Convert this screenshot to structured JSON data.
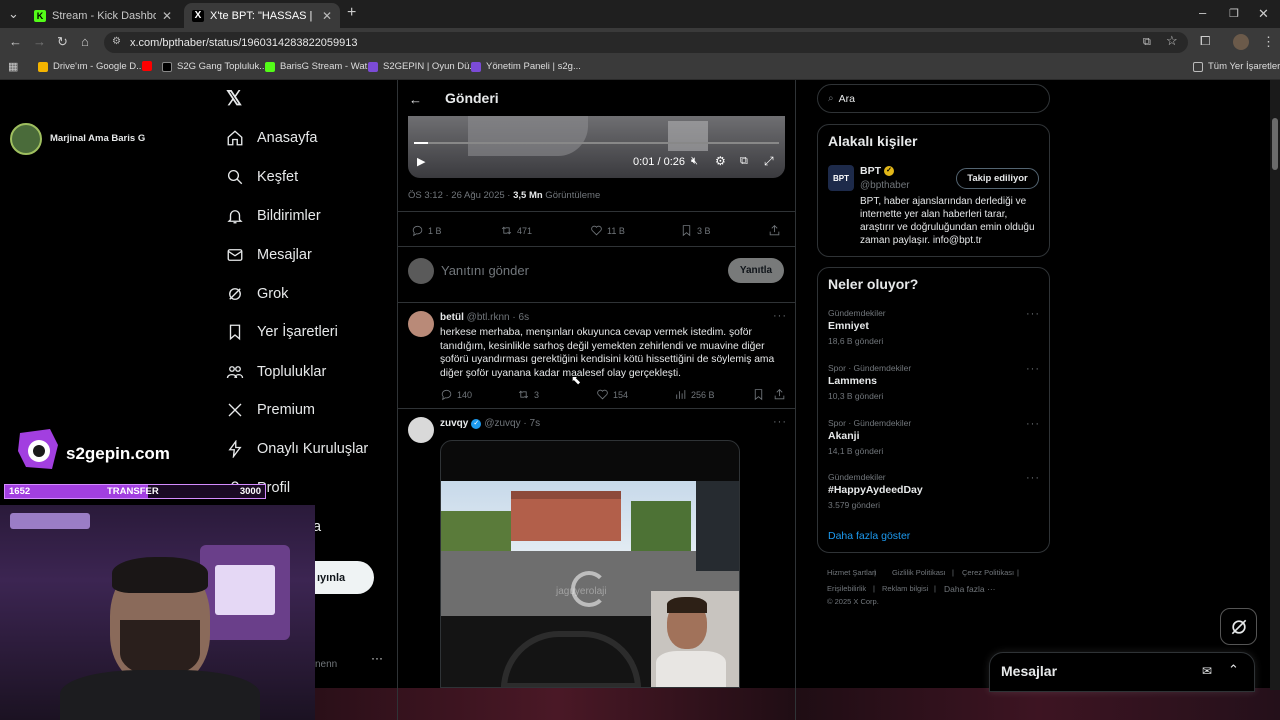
{
  "browser": {
    "tabs": [
      {
        "title": "Stream - Kick Dashboard",
        "favicon_color": "#53fc18",
        "favicon_text": "K"
      },
      {
        "title": "X'te BPT: \"HASSAS | Samsun'da",
        "favicon_color": "#000000",
        "favicon_text": "X"
      }
    ],
    "url": "x.com/bpthaber/status/1960314283822059913",
    "bookmarks": [
      {
        "label": "Drive'ım - Google D...",
        "color": "#f4b400"
      },
      {
        "label": "S2G Gang Topluluk...",
        "color": "#000000"
      },
      {
        "label": "BarisG Stream - Wat...",
        "color": "#53fc18"
      },
      {
        "label": "S2GEPIN | Oyun Dü...",
        "color": "#7b4bd6"
      },
      {
        "label": "Yönetim Paneli | s2g...",
        "color": "#7b4bd6"
      }
    ],
    "all_bookmarks": "Tüm Yer İşaretleri"
  },
  "nav": {
    "items": [
      {
        "label": "Anasayfa",
        "icon": "home-icon"
      },
      {
        "label": "Keşfet",
        "icon": "search-icon"
      },
      {
        "label": "Bildirimler",
        "icon": "bell-icon"
      },
      {
        "label": "Mesajlar",
        "icon": "mail-icon"
      },
      {
        "label": "Grok",
        "icon": "grok-icon"
      },
      {
        "label": "Yer İşaretleri",
        "icon": "bookmark-icon"
      },
      {
        "label": "Topluluklar",
        "icon": "people-icon"
      },
      {
        "label": "Premium",
        "icon": "x-icon"
      },
      {
        "label": "Onaylı Kuruluşlar",
        "icon": "lightning-icon"
      },
      {
        "label": "Profil",
        "icon": "user-icon"
      },
      {
        "label": "a",
        "icon": "more-icon"
      }
    ],
    "post_button": "ıyınla",
    "account_fragment": "nenn"
  },
  "overlay": {
    "streamer_name": "Marjinal Ama Baris G",
    "brand": "s2gepin.com",
    "bar_left": "1652",
    "bar_mid": "TRANSFER",
    "bar_right": "3000",
    "bar_progress": 0.55
  },
  "post": {
    "header": "Gönderi",
    "video_time": "0:01 / 0:26",
    "meta_time": "ÖS 3:12 · 26 Ağu 2025 · ",
    "views_count": "3,5 Mn",
    "views_label": " Görüntüleme",
    "replies": "1 B",
    "reposts": "471",
    "likes": "11 B",
    "bookmarks": "3 B",
    "reply_placeholder": "Yanıtını gönder",
    "reply_button": "Yanıtla"
  },
  "replies": [
    {
      "name": "betül",
      "handle": "@btl.rknn · 6s",
      "text": "herkese merhaba, menşınları okuyunca cevap vermek istedim. şoför tanıdığım, kesinlikle sarhoş değil yemekten zehirlendi ve muavine diğer şoförü uyandırması gerektiğini kendisini kötü hissettiğini de söylemiş ama diğer şoför uyanana kadar maalesef olay gerçekleşti.",
      "replies": "140",
      "reposts": "3",
      "likes": "154",
      "views": "256 B"
    },
    {
      "name": "zuvqy",
      "handle": "@zuvqy · 7s",
      "verified": true,
      "watermark": "jaguyerolaji"
    }
  ],
  "right": {
    "search_placeholder": "Ara",
    "relevant_title": "Alakalı kişiler",
    "person": {
      "name": "BPT",
      "handle": "@bpthaber",
      "avatar_text": "BPT",
      "follow_button": "Takip ediliyor",
      "bio": "BPT, haber ajanslarından derlediği ve internette yer alan haberleri tarar, araştırır ve doğruluğundan emin olduğu zaman paylaşır. info@bpt.tr"
    },
    "trends_title": "Neler oluyor?",
    "trends": [
      {
        "category": "Gündemdekiler",
        "name": "Emniyet",
        "count": "18,6 B gönderi"
      },
      {
        "category": "Spor · Gündemdekiler",
        "name": "Lammens",
        "count": "10,3 B gönderi"
      },
      {
        "category": "Spor · Gündemdekiler",
        "name": "Akanji",
        "count": "14,1 B gönderi"
      },
      {
        "category": "Gündemdekiler",
        "name": "#HappyAydeedDay",
        "count": "3.579 gönderi"
      }
    ],
    "show_more": "Daha fazla göster",
    "footer": [
      "Hizmet Şartları",
      "Gizlilik Politikası",
      "Çerez Politikası",
      "Erişilebilirlik",
      "Reklam bilgisi",
      "Daha fazla ···",
      "© 2025 X Corp."
    ],
    "messages_title": "Mesajlar"
  },
  "colors": {
    "accent": "#1d9bf0",
    "border": "#2f3336",
    "muted": "#71767b",
    "overlay_purple": "#a23fe0"
  }
}
